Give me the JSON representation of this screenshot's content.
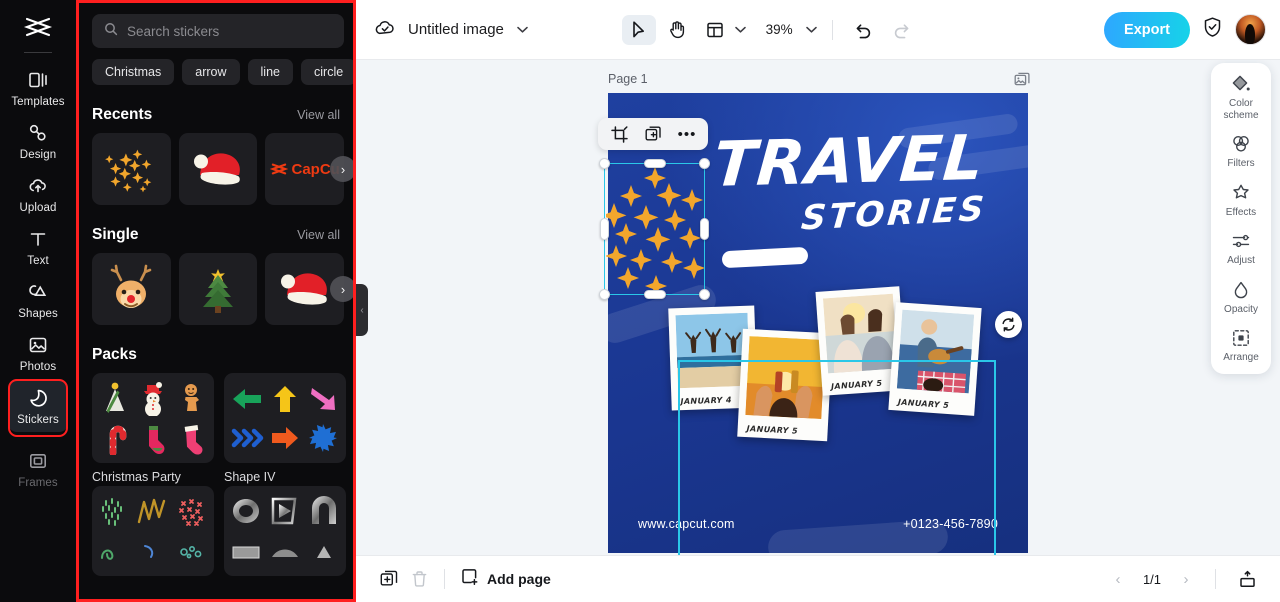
{
  "rail": {
    "logo_icon": "capcut-logo-icon",
    "items": [
      {
        "label": "Templates",
        "icon": "templates-icon",
        "active": false,
        "dim": false
      },
      {
        "label": "Design",
        "icon": "design-icon",
        "active": false,
        "dim": false
      },
      {
        "label": "Upload",
        "icon": "upload-cloud-icon",
        "active": false,
        "dim": false
      },
      {
        "label": "Text",
        "icon": "text-icon",
        "active": false,
        "dim": false
      },
      {
        "label": "Shapes",
        "icon": "shapes-icon",
        "active": false,
        "dim": false
      },
      {
        "label": "Photos",
        "icon": "photos-icon",
        "active": false,
        "dim": false
      },
      {
        "label": "Stickers",
        "icon": "stickers-icon",
        "active": true,
        "dim": false
      },
      {
        "label": "Frames",
        "icon": "frames-icon",
        "active": false,
        "dim": true
      }
    ]
  },
  "panel": {
    "search": {
      "placeholder": "Search stickers",
      "icon": "search-icon"
    },
    "chips": [
      "Christmas",
      "arrow",
      "line",
      "circle"
    ],
    "sections": [
      {
        "title": "Recents",
        "view_all": "View all"
      },
      {
        "title": "Single",
        "view_all": "View all"
      },
      {
        "title": "Packs",
        "view_all": ""
      }
    ],
    "recents": [
      {
        "name": "sparkle-burst-sticker"
      },
      {
        "name": "santa-hat-sticker"
      },
      {
        "name": "capcut-logo-sticker",
        "text": "CapCu"
      }
    ],
    "single": [
      {
        "name": "reindeer-sticker"
      },
      {
        "name": "christmas-tree-sticker"
      },
      {
        "name": "santa-hat-sticker"
      }
    ],
    "packs": [
      {
        "name": "Christmas Party"
      },
      {
        "name": "Shape IV"
      },
      {
        "name": ""
      },
      {
        "name": ""
      }
    ],
    "next_arrow": "›",
    "collapse_arrow": "‹"
  },
  "topbar": {
    "cloud_icon": "cloud-saved-icon",
    "doc_title": "Untitled image",
    "title_chevron": "⌄",
    "tools": [
      {
        "name": "select-tool",
        "selected": true
      },
      {
        "name": "hand-tool",
        "selected": false
      },
      {
        "name": "layout-tool",
        "selected": false
      }
    ],
    "zoom": "39%",
    "undo_icon": "undo-icon",
    "redo_icon": "redo-icon",
    "export_label": "Export",
    "shield_icon": "shield-check-icon",
    "avatar": "user-avatar"
  },
  "canvas": {
    "page_label": "Page 1",
    "page_icon": "duplicate-page-icon",
    "design": {
      "title_line1": "TRAVEL",
      "title_line2": "STORIES",
      "website": "www.capcut.com",
      "phone": "+0123-456-7890",
      "photo_captions": [
        "JANUARY 4",
        "JANUARY 5",
        "JANUARY 5",
        "JANUARY 5"
      ],
      "background_color": "#1e3f9c"
    },
    "selection": {
      "accent_color": "#2ac7e8",
      "floating_tools": [
        {
          "name": "crop-icon"
        },
        {
          "name": "duplicate-icon"
        },
        {
          "name": "more-options-icon",
          "glyph": "•••"
        }
      ],
      "rotate_icon": "rotate-icon"
    }
  },
  "right_panel": {
    "items": [
      {
        "label": "Color\nscheme",
        "label_l1": "Color",
        "label_l2": "scheme",
        "icon": "color-scheme-icon"
      },
      {
        "label": "Filters",
        "icon": "filters-icon"
      },
      {
        "label": "Effects",
        "icon": "effects-icon"
      },
      {
        "label": "Adjust",
        "icon": "adjust-icon"
      },
      {
        "label": "Opacity",
        "icon": "opacity-icon"
      },
      {
        "label": "Arrange",
        "icon": "arrange-icon"
      }
    ]
  },
  "bottombar": {
    "duplicate_icon": "duplicate-page-icon",
    "delete_icon": "trash-icon",
    "add_page_label": "Add page",
    "add_page_icon": "add-page-icon",
    "prev_arrow": "‹",
    "page_indicator": "1/1",
    "next_arrow": "›",
    "present_icon": "present-icon"
  },
  "colors": {
    "accent": "#2ac7e8",
    "highlight": "#ff1f1f",
    "export_gradient_from": "#2ea7ff",
    "export_gradient_to": "#16d3e8",
    "panel_bg": "#0b0b0d",
    "workspace_bg": "#f2f5f8"
  }
}
